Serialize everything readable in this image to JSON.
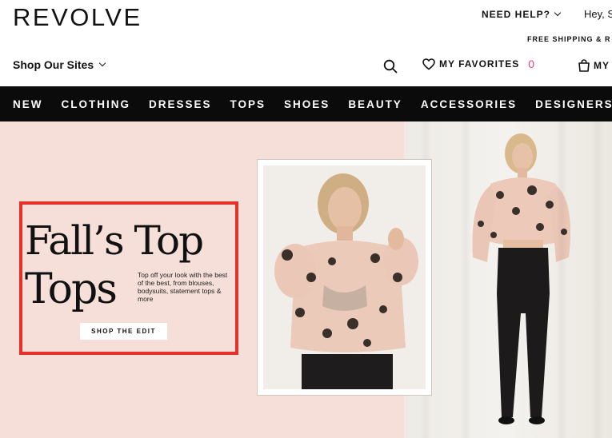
{
  "header": {
    "logo": "REVOLVE",
    "need_help": "NEED HELP?",
    "greeting": "Hey, S",
    "free_shipping": "FREE SHIPPING & R",
    "shop_sites": "Shop Our Sites",
    "favorites_label": "MY FAVORITES",
    "favorites_count": "0",
    "account_label": "MY"
  },
  "nav": {
    "items": [
      "NEW",
      "CLOTHING",
      "DRESSES",
      "TOPS",
      "SHOES",
      "BEAUTY",
      "ACCESSORIES",
      "DESIGNERS"
    ]
  },
  "hero": {
    "title_line1": "Fall’s Top",
    "title_line2": "Tops",
    "subtitle": "Top off your look with the best of the best, from blouses, bodysuits, statement tops & more",
    "cta": "SHOP THE EDIT"
  },
  "colors": {
    "nav_bg": "#0b0b0b",
    "hero_bg": "#f6dfd8",
    "highlight_border": "#e8302a",
    "favorites_count": "#e0457b"
  }
}
